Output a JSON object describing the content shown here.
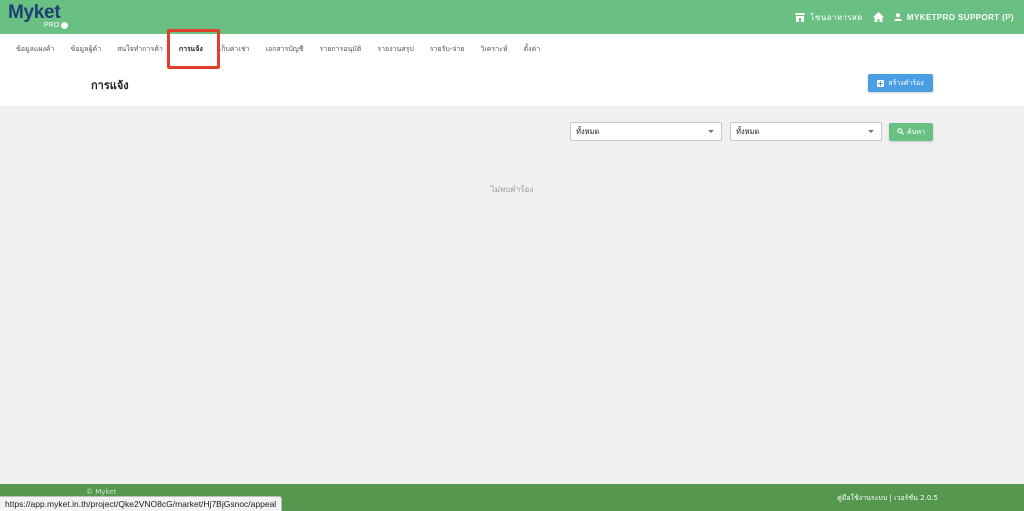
{
  "app": {
    "logo": "Myket",
    "logo_sub": "PRO"
  },
  "topbar": {
    "store_label": "โชนอาหารสด",
    "user_label": "MYKETPRO SUPPORT (P)"
  },
  "nav": {
    "items": [
      {
        "label": "ข้อมูลแผงค้า",
        "active": false
      },
      {
        "label": "ข้อมูลผู้ค้า",
        "active": false
      },
      {
        "label": "สนใจทำการค้า",
        "active": false
      },
      {
        "label": "การแจ้ง",
        "active": true
      },
      {
        "label": "เก็บค่าเช่า",
        "active": false
      },
      {
        "label": "เอกสารบัญชี",
        "active": false
      },
      {
        "label": "รายการอนุมัติ",
        "active": false
      },
      {
        "label": "รายงานสรุป",
        "active": false
      },
      {
        "label": "รายรับ-จ่าย",
        "active": false
      },
      {
        "label": "วิเคราะห์",
        "active": false
      },
      {
        "label": "ตั้งค่า",
        "active": false
      }
    ]
  },
  "page": {
    "title": "การแจ้ง",
    "create_button": "สร้างคำร้อง"
  },
  "filters": {
    "filter1_value": "ทั้งหมด",
    "filter2_value": "ทั้งหมด",
    "search_button": "ค้นหา"
  },
  "content": {
    "empty_message": "ไม่พบคำร้อง"
  },
  "footer": {
    "left_text": "© Myket",
    "right_text": "คู่มือใช้งานระบบ | เวอร์ชั่น 2.0.5"
  },
  "status_bar": {
    "url": "https://app.myket.in.th/project/Qke2VNO8cG/market/Hj7BjGsnoc/appeal"
  },
  "colors": {
    "topbar": "#6abf83",
    "primary_button": "#4a9fe2",
    "search_button": "#6abf83",
    "footer": "#55974f",
    "highlight": "#e0402a"
  }
}
